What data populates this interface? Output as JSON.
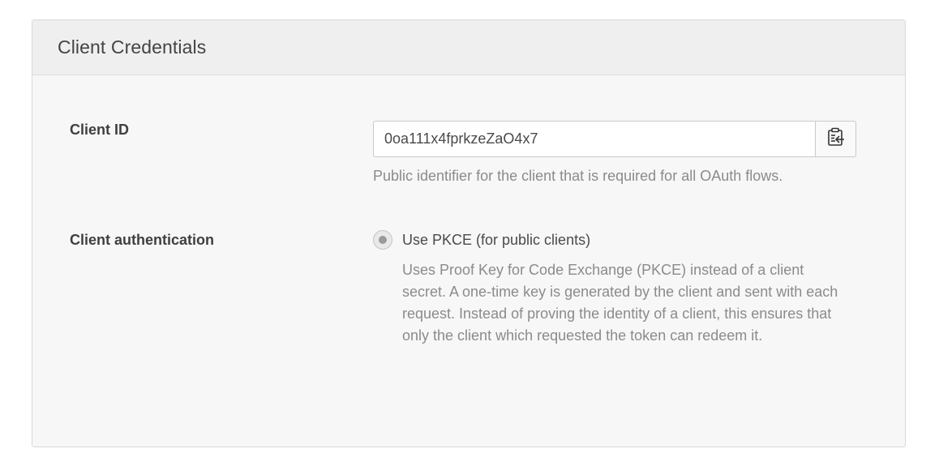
{
  "panel": {
    "title": "Client Credentials"
  },
  "client_id": {
    "label": "Client ID",
    "value": "0oa111x4fprkzeZaO4x7",
    "help": "Public identifier for the client that is required for all OAuth flows.",
    "copy_icon": "clipboard-copy-icon"
  },
  "client_auth": {
    "label": "Client authentication",
    "option_label": "Use PKCE (for public clients)",
    "option_selected": true,
    "option_description": "Uses Proof Key for Code Exchange (PKCE) instead of a client secret. A one-time key is generated by the client and sent with each request. Instead of proving the identity of a client, this ensures that only the client which requested the token can redeem it."
  }
}
